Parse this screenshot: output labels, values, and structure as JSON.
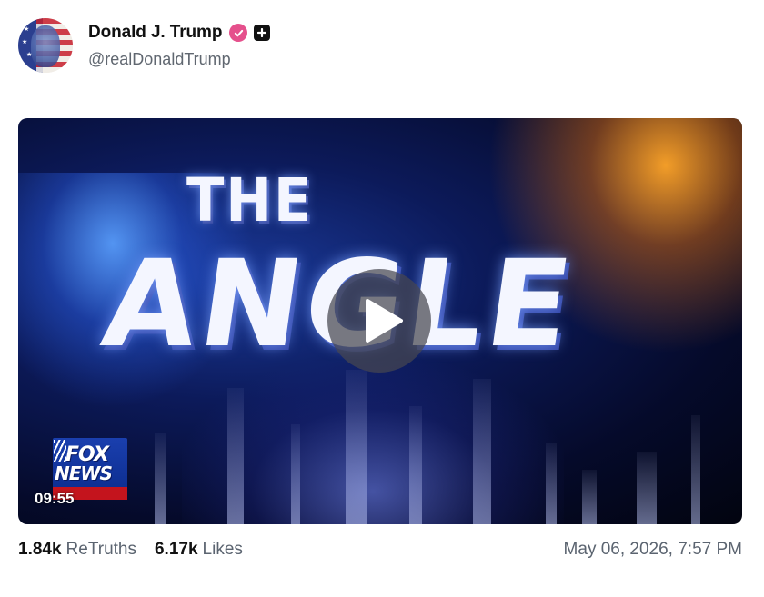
{
  "author": {
    "display_name": "Donald J. Trump",
    "handle": "@realDonaldTrump",
    "avatar_icon": "flag-portrait-avatar",
    "verified_icon": "verified-check-icon",
    "verified_color": "#e5508c",
    "badge_icon": "plus-badge-icon"
  },
  "video": {
    "title_line1": "THE",
    "title_line2": "ANGLE",
    "network_logo_line1": "FOX",
    "network_logo_line2": "NEWS",
    "duration": "09:55",
    "play_icon": "play-icon"
  },
  "stats": {
    "retruths_count": "1.84k",
    "retruths_label": "ReTruths",
    "likes_count": "6.17k",
    "likes_label": "Likes"
  },
  "post_date": "May 06, 2026, 7:57 PM"
}
